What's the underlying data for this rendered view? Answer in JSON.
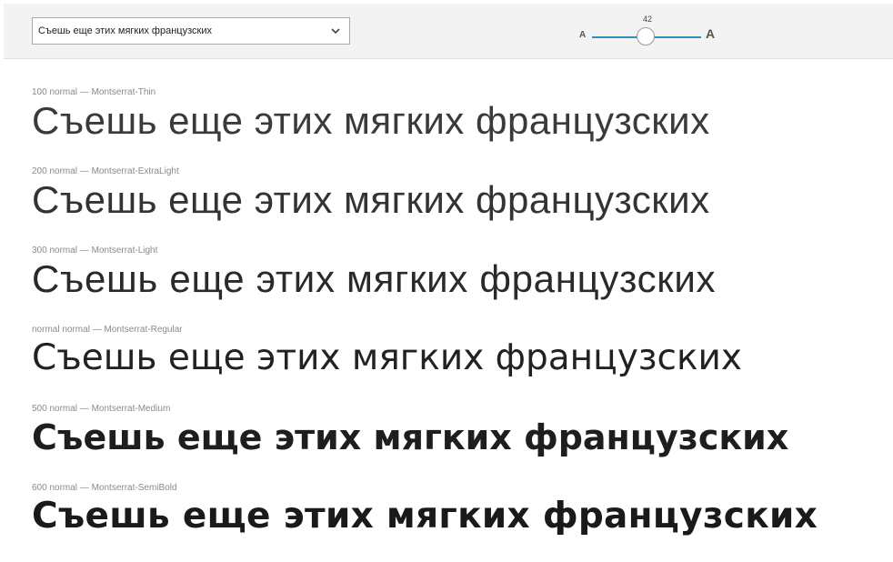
{
  "toolbar": {
    "sample_select": {
      "value": "Съешь еще этих мягких французских"
    },
    "size_slider": {
      "small_label": "A",
      "large_label": "A",
      "value": "42"
    }
  },
  "specimens": [
    {
      "meta": "100 normal — Montserrat-Thin",
      "sample": "Съешь еще этих мягких французских"
    },
    {
      "meta": "200 normal — Montserrat-ExtraLight",
      "sample": "Съешь еще этих мягких французских"
    },
    {
      "meta": "300 normal — Montserrat-Light",
      "sample": "Съешь еще этих мягких французских"
    },
    {
      "meta": "normal normal — Montserrat-Regular",
      "sample": "Съешь еще этих мягких французских"
    },
    {
      "meta": "500 normal — Montserrat-Medium",
      "sample": "Съешь еще этих мягких французских"
    },
    {
      "meta": "600 normal — Montserrat-SemiBold",
      "sample": "Съешь еще этих мягких французских"
    }
  ],
  "colors": {
    "slider_accent": "#2e8fbd",
    "toolbar_bg": "#f3f3f3"
  }
}
